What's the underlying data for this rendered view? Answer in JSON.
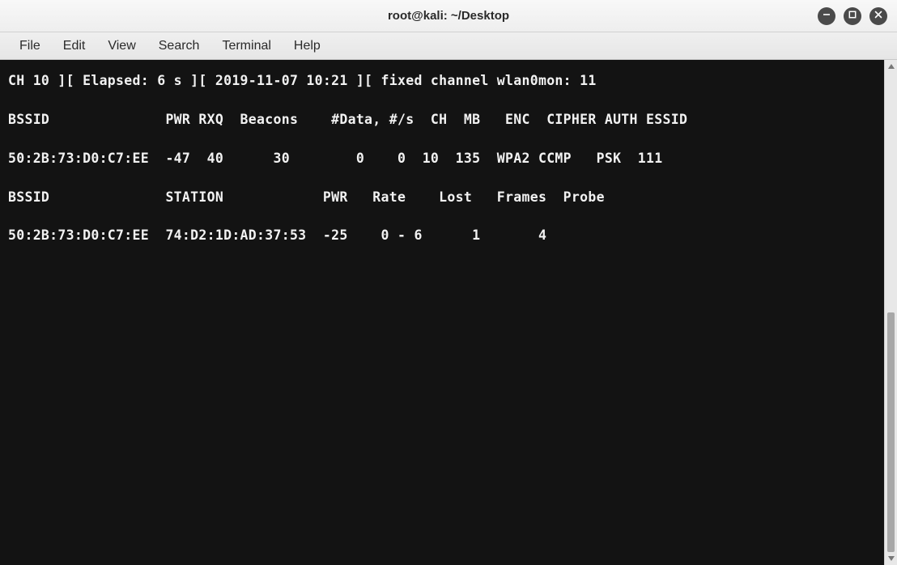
{
  "window": {
    "title": "root@kali: ~/Desktop"
  },
  "menubar": {
    "items": [
      "File",
      "Edit",
      "View",
      "Search",
      "Terminal",
      "Help"
    ]
  },
  "terminal": {
    "status_line": "CH 10 ][ Elapsed: 6 s ][ 2019-11-07 10:21 ][ fixed channel wlan0mon: 11",
    "ap_header": "BSSID              PWR RXQ  Beacons    #Data, #/s  CH  MB   ENC  CIPHER AUTH ESSID",
    "ap_row1": "50:2B:73:D0:C7:EE  -47  40      30        0    0  10  135  WPA2 CCMP   PSK  111",
    "sta_header": "BSSID              STATION            PWR   Rate    Lost   Frames  Probe",
    "sta_row1": "50:2B:73:D0:C7:EE  74:D2:1D:AD:37:53  -25    0 - 6      1       4"
  },
  "scrollbar": {
    "thumb_top_pct": 50,
    "thumb_height_pct": 50
  }
}
